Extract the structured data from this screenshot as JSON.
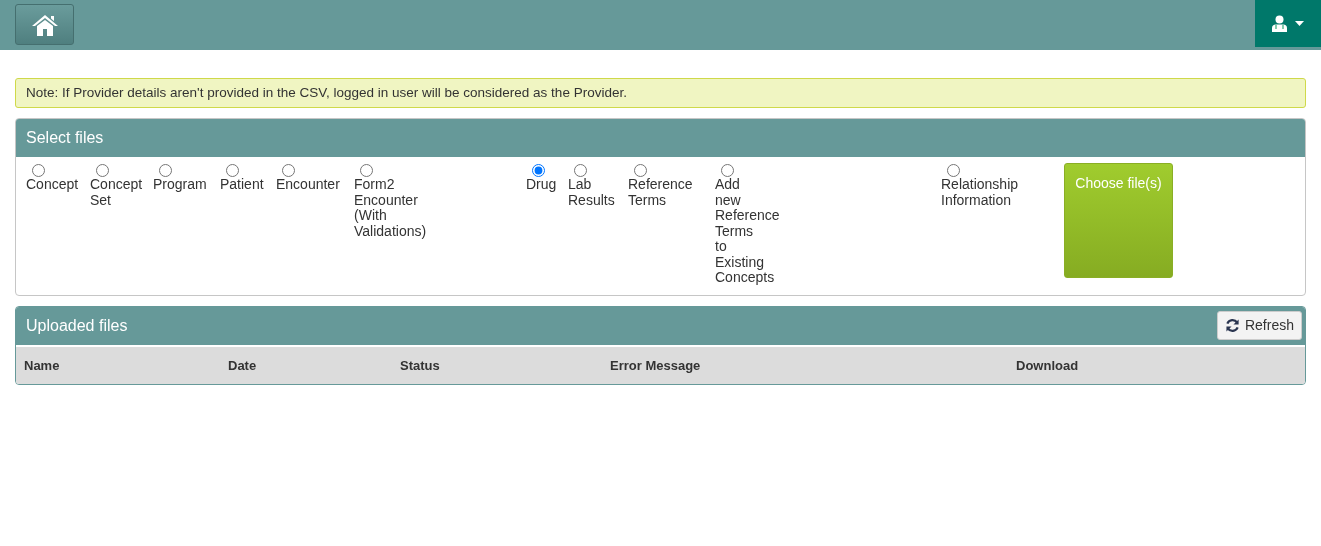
{
  "note": "Note: If Provider details aren't provided in the CSV, logged in user will be considered as the Provider.",
  "select_files": {
    "title": "Select files",
    "options": [
      {
        "label": "Concept",
        "selected": false
      },
      {
        "label": "Concept Set",
        "selected": false
      },
      {
        "label": "Program",
        "selected": false
      },
      {
        "label": "Patient",
        "selected": false
      },
      {
        "label": "Encounter",
        "selected": false
      },
      {
        "label": "Form2 Encounter (With Validations)",
        "selected": false
      },
      {
        "label": "Drug",
        "selected": true
      },
      {
        "label": "Lab Results",
        "selected": false
      },
      {
        "label": "Reference Terms",
        "selected": false
      },
      {
        "label": "Add new Reference Terms to Existing Concepts",
        "selected": false
      },
      {
        "label": "Relationship Information",
        "selected": false
      }
    ],
    "button": "Choose file(s)"
  },
  "uploaded_files": {
    "title": "Uploaded files",
    "refresh": "Refresh",
    "columns": [
      "Name",
      "Date",
      "Status",
      "Error Message",
      "Download"
    ]
  }
}
